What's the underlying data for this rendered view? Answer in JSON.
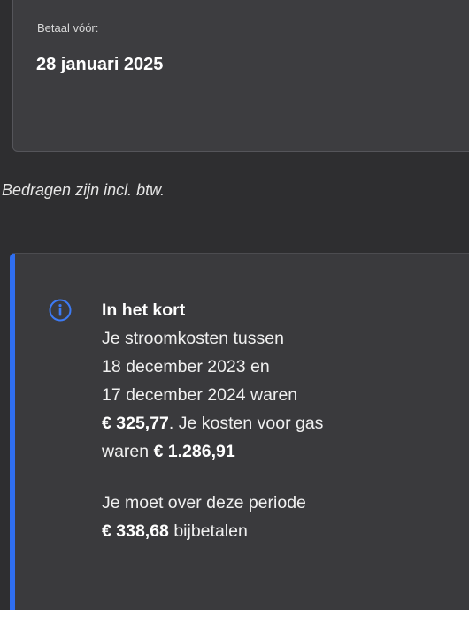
{
  "due": {
    "label": "Betaal vóór:",
    "date": "28 januari 2025"
  },
  "vat_note": "Bedragen zijn incl. btw.",
  "summary": {
    "icon": "info-icon",
    "accent_color": "#2f6ef0",
    "title": "In het kort",
    "line1": "Je stroomkosten tussen",
    "line2": "18 december 2023 en",
    "line3": "17 december 2024 waren",
    "electricity_amount": "€ 325,77",
    "line4_rest": ". Je kosten voor gas",
    "line5_prefix": "waren ",
    "gas_amount": "€ 1.286,91",
    "line6": "Je moet over deze periode",
    "payment_amount": "€ 338,68",
    "line7_rest": " bijbetalen"
  }
}
